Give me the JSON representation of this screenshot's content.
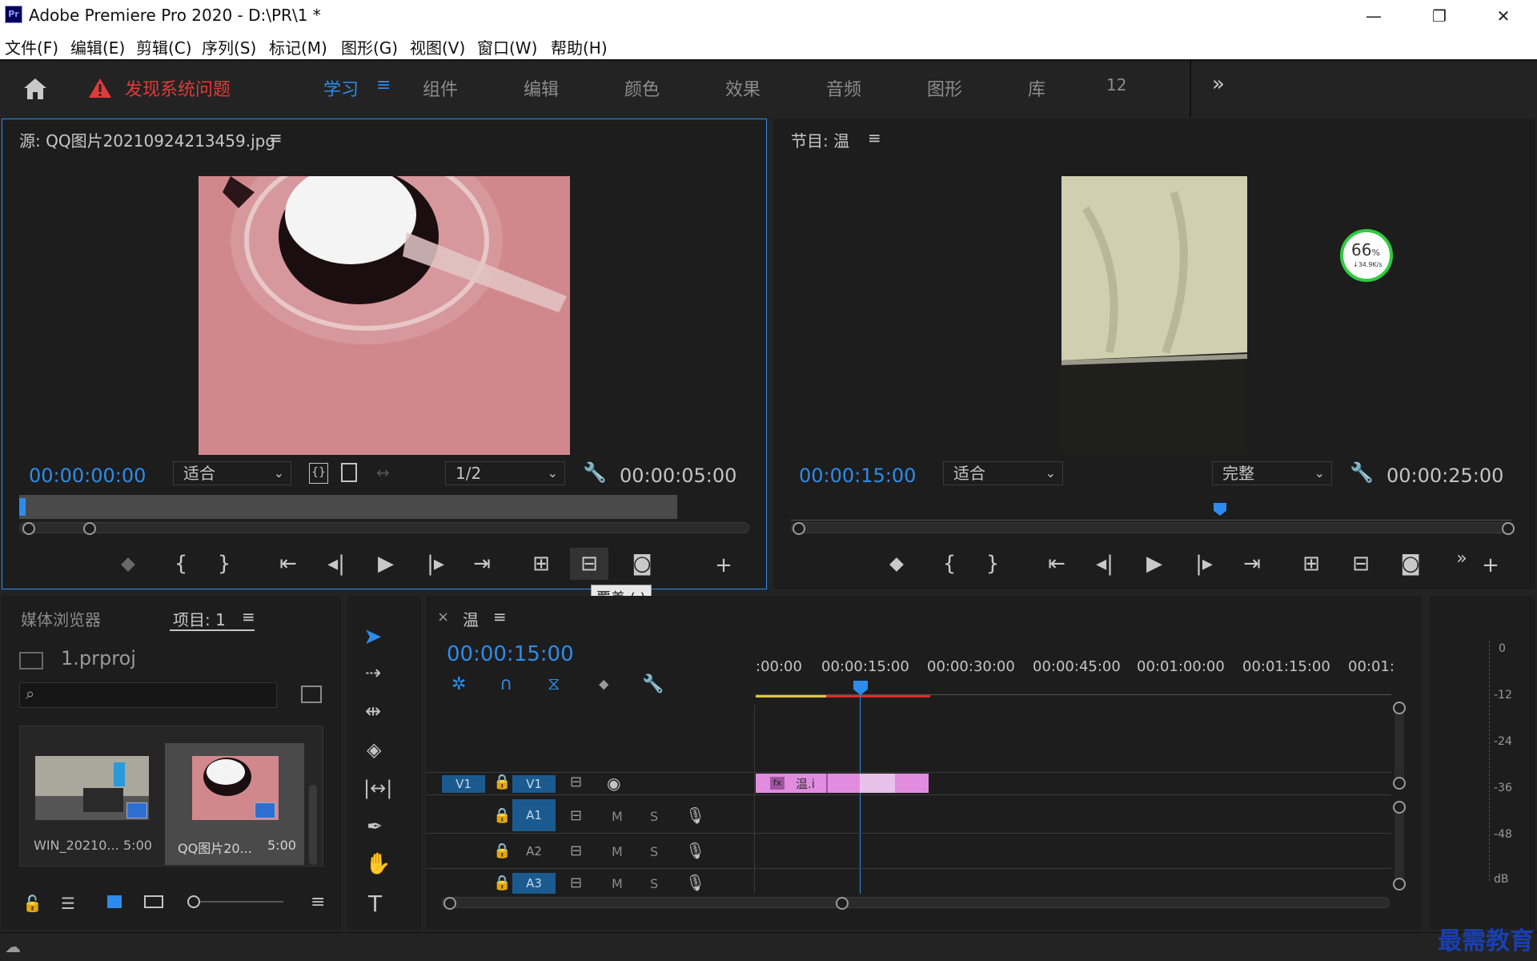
{
  "titlebar": {
    "app_badge": "Pr",
    "title": "Adobe Premiere Pro 2020 - D:\\PR\\1 *",
    "minimize": "—",
    "restore": "❐",
    "close": "✕"
  },
  "menu": [
    "文件(F)",
    "编辑(E)",
    "剪辑(C)",
    "序列(S)",
    "标记(M)",
    "图形(G)",
    "视图(V)",
    "窗口(W)",
    "帮助(H)"
  ],
  "workspace": {
    "alert": "发现系统问题",
    "tabs": [
      "学习",
      "组件",
      "编辑",
      "颜色",
      "效果",
      "音频",
      "图形",
      "库",
      "12"
    ],
    "active_tab": "学习",
    "more": "»"
  },
  "source": {
    "title": "源: QQ图片20210924213459.jpg",
    "timecode_in": "00:00:00:00",
    "zoom": "适合",
    "resolution": "1/2",
    "duration": "00:00:05:00",
    "tooltip": "覆盖 (.)"
  },
  "program": {
    "title": "节目: 温",
    "timecode": "00:00:15:00",
    "zoom": "适合",
    "quality": "完整",
    "duration": "00:00:25:00",
    "net_meter_percent": "66",
    "net_meter_unit": "%",
    "net_meter_speed": "↓34.9K/s"
  },
  "project": {
    "tab_media": "媒体浏览器",
    "tab_project": "项目: 1",
    "project_file": "1.prproj",
    "search_placeholder": "",
    "items": [
      {
        "name": "WIN_20210...",
        "duration": "5:00"
      },
      {
        "name": "QQ图片20...",
        "duration": "5:00"
      }
    ]
  },
  "timeline": {
    "close": "×",
    "sequence": "温",
    "timecode": "00:00:15:00",
    "ruler": [
      ":00:00",
      "00:00:15:00",
      "00:00:30:00",
      "00:00:45:00",
      "00:01:00:00",
      "00:01:15:00",
      "00:01:"
    ],
    "tracks": {
      "v1_src": "V1",
      "v1": "V1",
      "a1": "A1",
      "a2": "A2",
      "a3": "A3",
      "m": "M",
      "s": "S"
    },
    "clip_label": "温.i",
    "clip_fx": "fx"
  },
  "meter": {
    "scale": [
      "0",
      "-12",
      "-24",
      "-36",
      "-48",
      "dB"
    ]
  },
  "watermark": "最需教育",
  "colors": {
    "accent_blue": "#2d8ceb",
    "alert_red": "#e03a3a",
    "clip_pink": "#e28ce0",
    "playhead_blue": "#2d8ceb"
  }
}
